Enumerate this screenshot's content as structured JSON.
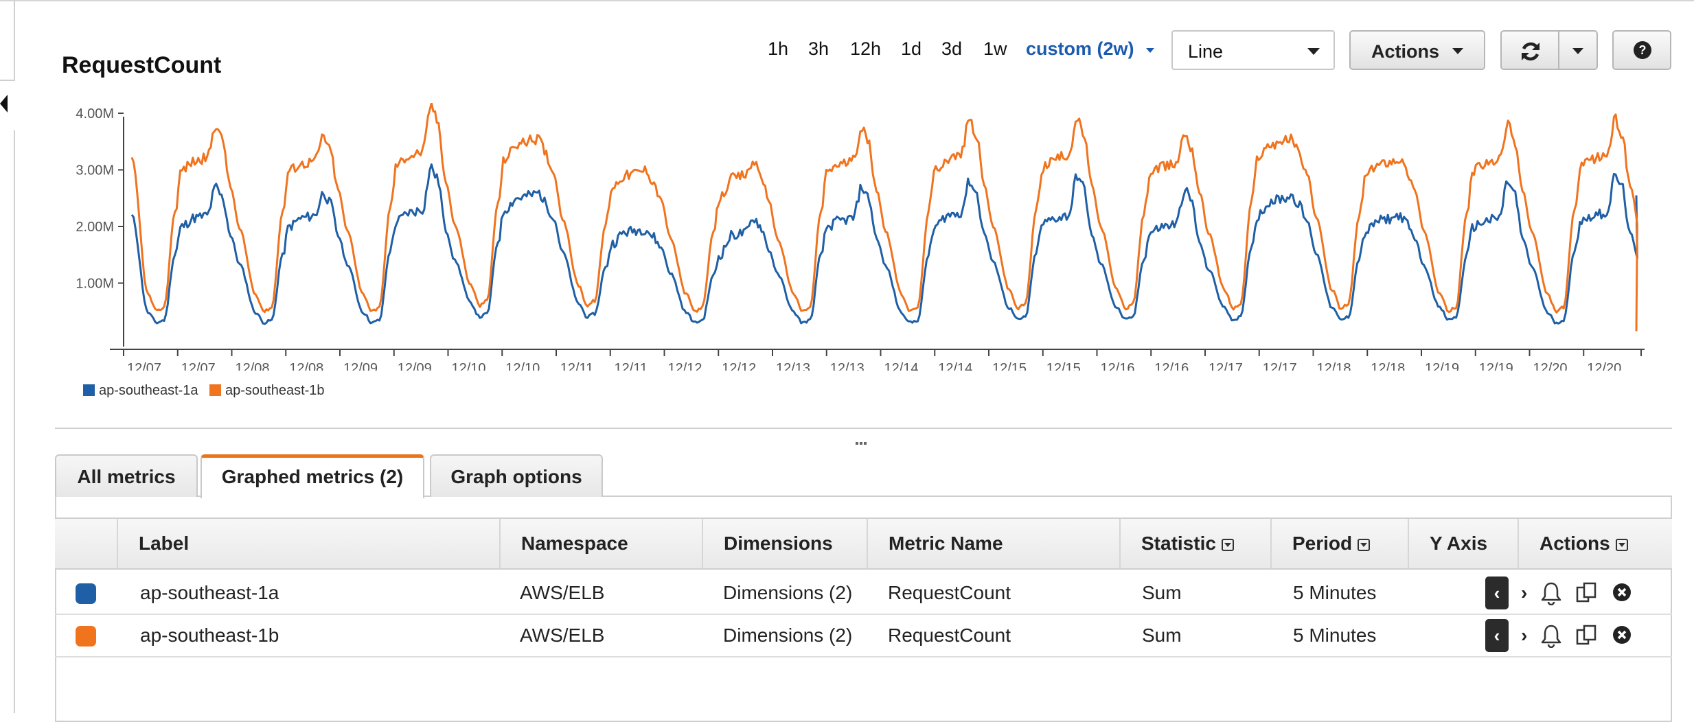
{
  "graph": {
    "title": "RequestCount",
    "time_ranges": [
      "1h",
      "3h",
      "12h",
      "1d",
      "3d",
      "1w",
      "custom (2w)"
    ],
    "active_range": "custom (2w)",
    "chart_type_value": "Line",
    "actions_label": "Actions"
  },
  "chart_data": {
    "type": "line",
    "title": "RequestCount",
    "ylabel": "",
    "xlabel": "",
    "y_ticks": [
      "1.00M",
      "2.00M",
      "3.00M",
      "4.00M"
    ],
    "ylim": [
      0,
      4.1
    ],
    "x_ticks": [
      "12/07",
      "12/07",
      "12/08",
      "12/08",
      "12/09",
      "12/09",
      "12/10",
      "12/10",
      "12/11",
      "12/11",
      "12/12",
      "12/12",
      "12/13",
      "12/13",
      "12/14",
      "12/14",
      "12/15",
      "12/15",
      "12/16",
      "12/16",
      "12/17",
      "12/17",
      "12/18",
      "12/18",
      "12/19",
      "12/19",
      "12/20",
      "12/20"
    ],
    "grid": false,
    "legend_position": "bottom-left",
    "series": [
      {
        "name": "ap-southeast-1a",
        "color": "#1f5fa5",
        "daily": [
          {
            "start": 2.2,
            "trough": 0.3,
            "morning": 2.0,
            "plateau": 2.15,
            "peak": 2.7
          },
          {
            "trough": 0.3,
            "morning": 2.0,
            "plateau": 2.15,
            "peak": 2.6
          },
          {
            "trough": 0.3,
            "morning": 2.1,
            "plateau": 2.25,
            "peak": 3.05
          },
          {
            "trough": 0.4,
            "morning": 2.3,
            "plateau": 2.5,
            "peak": 2.6
          },
          {
            "trough": 0.4,
            "morning": 1.7,
            "plateau": 1.9,
            "peak": 1.95
          },
          {
            "trough": 0.3,
            "morning": 1.5,
            "plateau": 1.85,
            "peak": 2.15
          },
          {
            "trough": 0.3,
            "morning": 2.0,
            "plateau": 2.1,
            "peak": 2.7
          },
          {
            "trough": 0.3,
            "morning": 2.0,
            "plateau": 2.2,
            "peak": 2.8
          },
          {
            "trough": 0.35,
            "morning": 2.05,
            "plateau": 2.15,
            "peak": 2.9
          },
          {
            "trough": 0.35,
            "morning": 1.9,
            "plateau": 2.0,
            "peak": 2.65
          },
          {
            "trough": 0.35,
            "morning": 2.2,
            "plateau": 2.45,
            "peak": 2.55
          },
          {
            "trough": 0.35,
            "morning": 1.9,
            "plateau": 2.1,
            "peak": 2.2
          },
          {
            "trough": 0.35,
            "morning": 2.0,
            "plateau": 2.1,
            "peak": 2.8
          },
          {
            "trough": 0.3,
            "morning": 2.1,
            "plateau": 2.2,
            "peak": 2.9,
            "end": 2.55
          }
        ]
      },
      {
        "name": "ap-southeast-1b",
        "color": "#f0731e",
        "daily": [
          {
            "start": 3.2,
            "trough": 0.5,
            "morning": 3.0,
            "plateau": 3.15,
            "peak": 3.8
          },
          {
            "trough": 0.5,
            "morning": 3.0,
            "plateau": 3.1,
            "peak": 3.6
          },
          {
            "trough": 0.5,
            "morning": 3.1,
            "plateau": 3.25,
            "peak": 4.15
          },
          {
            "trough": 0.6,
            "morning": 3.2,
            "plateau": 3.45,
            "peak": 3.55
          },
          {
            "trough": 0.6,
            "morning": 2.7,
            "plateau": 2.9,
            "peak": 3.0
          },
          {
            "trough": 0.5,
            "morning": 2.5,
            "plateau": 2.85,
            "peak": 3.15
          },
          {
            "trough": 0.5,
            "morning": 3.0,
            "plateau": 3.1,
            "peak": 3.75
          },
          {
            "trough": 0.5,
            "morning": 3.0,
            "plateau": 3.2,
            "peak": 3.9
          },
          {
            "trough": 0.55,
            "morning": 3.05,
            "plateau": 3.2,
            "peak": 3.9
          },
          {
            "trough": 0.55,
            "morning": 2.95,
            "plateau": 3.05,
            "peak": 3.65
          },
          {
            "trough": 0.55,
            "morning": 3.25,
            "plateau": 3.45,
            "peak": 3.55
          },
          {
            "trough": 0.55,
            "morning": 2.9,
            "plateau": 3.1,
            "peak": 3.2
          },
          {
            "trough": 0.5,
            "morning": 3.0,
            "plateau": 3.1,
            "peak": 3.8
          },
          {
            "trough": 0.5,
            "morning": 3.05,
            "plateau": 3.2,
            "peak": 3.9,
            "end": 0.15
          }
        ]
      }
    ]
  },
  "legend": {
    "items": [
      {
        "label": "ap-southeast-1a",
        "color": "#1f5fa5"
      },
      {
        "label": "ap-southeast-1b",
        "color": "#f0731e"
      }
    ]
  },
  "tabs": [
    "All metrics",
    "Graphed metrics (2)",
    "Graph options"
  ],
  "table": {
    "headers": [
      "Label",
      "Namespace",
      "Dimensions",
      "Metric Name",
      "Statistic",
      "Period",
      "Y Axis",
      "Actions"
    ],
    "rows": [
      {
        "color": "#1f5fa5",
        "label": "ap-southeast-1a",
        "namespace": "AWS/ELB",
        "dimensions": "Dimensions (2)",
        "metric": "RequestCount",
        "statistic": "Sum",
        "period": "5 Minutes"
      },
      {
        "color": "#f0731e",
        "label": "ap-southeast-1b",
        "namespace": "AWS/ELB",
        "dimensions": "Dimensions (2)",
        "metric": "RequestCount",
        "statistic": "Sum",
        "period": "5 Minutes"
      }
    ]
  },
  "icons": {
    "refresh": "refresh-icon",
    "dropdown": "chevron-down-icon",
    "help": "help-icon",
    "alarm": "bell-icon",
    "copy": "copy-icon",
    "remove": "close-circle-icon"
  }
}
